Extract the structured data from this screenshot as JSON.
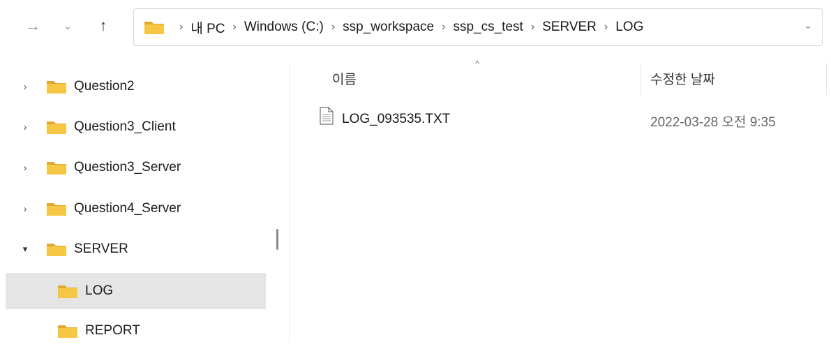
{
  "toolbar": {
    "back_icon": "arrow-right-icon",
    "recent_icon": "chevron-down-icon",
    "up_icon": "arrow-up-icon"
  },
  "address": {
    "crumbs": [
      "내 PC",
      "Windows (C:)",
      "ssp_workspace",
      "ssp_cs_test",
      "SERVER",
      "LOG"
    ]
  },
  "sidebar": {
    "items": [
      {
        "label": "Question2",
        "expand": "collapsed"
      },
      {
        "label": "Question3_Client",
        "expand": "collapsed"
      },
      {
        "label": "Question3_Server",
        "expand": "collapsed"
      },
      {
        "label": "Question4_Server",
        "expand": "collapsed"
      },
      {
        "label": "SERVER",
        "expand": "expanded"
      },
      {
        "label": "LOG",
        "selected": true
      },
      {
        "label": "REPORT"
      }
    ]
  },
  "filelist": {
    "col_name": "이름",
    "col_date": "수정한 날짜",
    "files": [
      {
        "name": "LOG_093535.TXT",
        "modified": "2022-03-28 오전 9:35"
      }
    ]
  },
  "colors": {
    "folder": "#f6c744",
    "folder_dark": "#e0a82e",
    "selected_bg": "#e5e5e5"
  }
}
